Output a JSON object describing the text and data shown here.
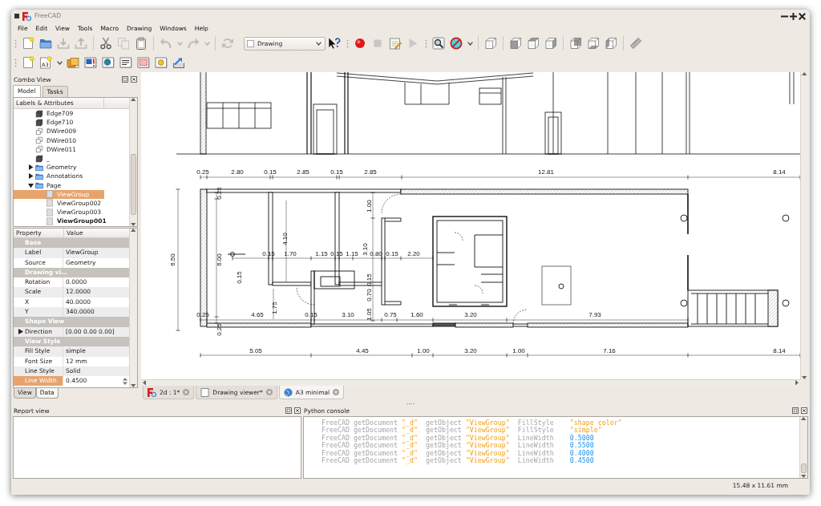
{
  "window": {
    "title": "FreeCAD"
  },
  "menu": [
    "File",
    "Edit",
    "View",
    "Tools",
    "Macro",
    "Drawing",
    "Windows",
    "Help"
  ],
  "toolbar_rows": [
    {
      "toolbars": [
        {
          "groups": [
            [
              {
                "kind": "new",
                "disabled": false
              },
              {
                "kind": "open",
                "disabled": false
              },
              {
                "kind": "save",
                "disabled": true
              },
              {
                "kind": "saveas",
                "disabled": true
              }
            ],
            [
              {
                "kind": "cut",
                "disabled": false
              },
              {
                "kind": "copy",
                "disabled": true
              },
              {
                "kind": "paste",
                "disabled": false
              }
            ],
            [
              {
                "kind": "undo",
                "disabled": true,
                "menu": true
              },
              {
                "kind": "redo",
                "disabled": true,
                "menu": true
              }
            ],
            [
              {
                "kind": "refresh",
                "disabled": true
              },
              {
                "kind": "workbench",
                "value": "Drawing",
                "disabled": false
              },
              {
                "kind": "whatsthis",
                "disabled": false
              }
            ]
          ]
        },
        {
          "groups": [
            [
              {
                "kind": "record",
                "disabled": false
              },
              {
                "kind": "stop",
                "disabled": true
              },
              {
                "kind": "macro",
                "disabled": false
              },
              {
                "kind": "play",
                "disabled": true
              }
            ]
          ]
        },
        {
          "groups": [
            [
              {
                "kind": "fitall",
                "disabled": false
              },
              {
                "kind": "drawstyle",
                "disabled": false,
                "menu": true
              }
            ],
            [
              {
                "kind": "isometric",
                "disabled": false
              }
            ],
            [
              {
                "kind": "front",
                "disabled": false
              },
              {
                "kind": "top",
                "disabled": false
              },
              {
                "kind": "right",
                "disabled": false
              }
            ],
            [
              {
                "kind": "rear",
                "disabled": false
              },
              {
                "kind": "bottom",
                "disabled": false
              },
              {
                "kind": "left",
                "disabled": false
              }
            ],
            [
              {
                "kind": "measure",
                "disabled": false
              }
            ]
          ]
        }
      ]
    },
    {
      "toolbars": [
        {
          "groups": [
            [
              {
                "kind": "newpage",
                "disabled": false
              },
              {
                "kind": "template",
                "label": "A3",
                "disabled": false,
                "menu": true
              },
              {
                "kind": "insertview",
                "disabled": false
              },
              {
                "kind": "projection",
                "disabled": false
              },
              {
                "kind": "openbrowser",
                "disabled": false
              },
              {
                "kind": "annotation",
                "disabled": false
              },
              {
                "kind": "clip",
                "disabled": false
              },
              {
                "kind": "symbol",
                "disabled": false
              },
              {
                "kind": "exportpage",
                "disabled": false
              }
            ]
          ]
        }
      ]
    }
  ],
  "combo_view": {
    "title": "Combo View",
    "tabs": [
      {
        "label": "Model",
        "selected": true
      },
      {
        "label": "Tasks",
        "selected": false
      }
    ],
    "tree": {
      "header": "Labels & Attributes",
      "items": [
        {
          "kind": "solid",
          "label": "Edge709",
          "selected": false
        },
        {
          "kind": "solid",
          "label": "Edge710",
          "selected": false
        },
        {
          "kind": "wire",
          "label": "DWire009",
          "selected": false
        },
        {
          "kind": "wire",
          "label": "DWire010",
          "selected": false
        },
        {
          "kind": "wire",
          "label": "DWire011",
          "selected": false
        },
        {
          "kind": "solid",
          "label": "_",
          "selected": false
        },
        {
          "kind": "folder",
          "label": "Geometry",
          "selected": false,
          "expanded": false
        },
        {
          "kind": "folder",
          "label": "Annotations",
          "selected": false,
          "expanded": false
        },
        {
          "kind": "folder",
          "label": "Page",
          "selected": false,
          "expanded": true,
          "children": [
            {
              "kind": "view",
              "label": "ViewGroup",
              "selected": true,
              "active": false
            },
            {
              "kind": "view",
              "label": "ViewGroup002",
              "selected": false,
              "active": false
            },
            {
              "kind": "view",
              "label": "ViewGroup003",
              "selected": false,
              "active": false
            },
            {
              "kind": "view",
              "label": "ViewGroup001",
              "selected": false,
              "active": true
            }
          ]
        }
      ]
    },
    "properties": {
      "columns": [
        "Property",
        "Value"
      ],
      "rows": [
        {
          "kind": "group",
          "label": "Base"
        },
        {
          "kind": "property",
          "name": "Label",
          "value": "ViewGroup",
          "selected": false
        },
        {
          "kind": "property",
          "name": "Source",
          "value": "Geometry",
          "selected": false
        },
        {
          "kind": "group",
          "label": "Drawing vi…"
        },
        {
          "kind": "property",
          "name": "Rotation",
          "value": "0.0000",
          "selected": false
        },
        {
          "kind": "property",
          "name": "Scale",
          "value": "12.0000",
          "selected": false
        },
        {
          "kind": "property",
          "name": "X",
          "value": "40.0000",
          "selected": false
        },
        {
          "kind": "property",
          "name": "Y",
          "value": "340.0000",
          "selected": false
        },
        {
          "kind": "group",
          "label": "Shape View"
        },
        {
          "kind": "property",
          "name": "Direction",
          "value": "[0.00 0.00 0.00]",
          "selected": false,
          "expanded": false
        },
        {
          "kind": "group",
          "label": "View Style"
        },
        {
          "kind": "property",
          "name": "Fill Style",
          "value": "simple",
          "selected": false
        },
        {
          "kind": "property",
          "name": "Font Size",
          "value": "12 mm",
          "selected": false
        },
        {
          "kind": "property",
          "name": "Line Style",
          "value": "Solid",
          "selected": false
        },
        {
          "kind": "property",
          "name": "Line Width",
          "value": "0.4500",
          "selected": true
        }
      ]
    },
    "bottom_tabs": [
      {
        "label": "View",
        "selected": false
      },
      {
        "label": "Data",
        "selected": true
      }
    ]
  },
  "drawing_view": {
    "dimension_labels": [
      "0.25",
      "2.80",
      "0.15",
      "2.85",
      "0.15",
      "2.85",
      "12.81",
      "8.14",
      "6.50",
      "0.25",
      "6.00",
      "4.10",
      "1.00",
      "0.15",
      "1.70",
      "1.15",
      "0.15",
      "1.15",
      "3.10",
      "0.80",
      "0.15",
      "2.20",
      "0.15",
      "0.15",
      "0.70",
      "1.75",
      "1.05",
      "0.25",
      "4.65",
      "0.15",
      "3.10",
      "0.75",
      "1.60",
      "3.20",
      "7.93",
      "0.25",
      "5.05",
      "4.45",
      "1.00",
      "3.20",
      "1.00",
      "7.16",
      "8.14"
    ]
  },
  "document_tabs": [
    {
      "kind": "document",
      "label": "2d : 1*",
      "selected": false
    },
    {
      "kind": "page",
      "label": "Drawing viewer*",
      "selected": false
    },
    {
      "kind": "web",
      "label": "A3 minimal",
      "selected": true
    }
  ],
  "report_view": {
    "title": "Report view"
  },
  "python_console": {
    "title": "Python console",
    "lines": [
      {
        "tokens": [
          {
            "kind": "code",
            "text": "FreeCAD getDocument"
          },
          {
            "kind": "string",
            "text": "\"_d\""
          },
          {
            "kind": "code",
            "text": "getObject"
          },
          {
            "kind": "string",
            "text": "\"ViewGroup\""
          },
          {
            "kind": "code",
            "text": "FillStyle"
          },
          {
            "kind": "string",
            "text": "\"shape color\""
          }
        ]
      },
      {
        "tokens": [
          {
            "kind": "code",
            "text": "FreeCAD getDocument"
          },
          {
            "kind": "string",
            "text": "\"_d\""
          },
          {
            "kind": "code",
            "text": "getObject"
          },
          {
            "kind": "string",
            "text": "\"ViewGroup\""
          },
          {
            "kind": "code",
            "text": "FillStyle"
          },
          {
            "kind": "string",
            "text": "\"simple\""
          }
        ]
      },
      {
        "tokens": [
          {
            "kind": "code",
            "text": "FreeCAD getDocument"
          },
          {
            "kind": "string",
            "text": "\"_d\""
          },
          {
            "kind": "code",
            "text": "getObject"
          },
          {
            "kind": "string",
            "text": "\"ViewGroup\""
          },
          {
            "kind": "code",
            "text": "LineWidth"
          },
          {
            "kind": "number",
            "text": "0.5000"
          }
        ]
      },
      {
        "tokens": [
          {
            "kind": "code",
            "text": "FreeCAD getDocument"
          },
          {
            "kind": "string",
            "text": "\"_d\""
          },
          {
            "kind": "code",
            "text": "getObject"
          },
          {
            "kind": "string",
            "text": "\"ViewGroup\""
          },
          {
            "kind": "code",
            "text": "LineWidth"
          },
          {
            "kind": "number",
            "text": "0.5500"
          }
        ]
      },
      {
        "tokens": [
          {
            "kind": "code",
            "text": "FreeCAD getDocument"
          },
          {
            "kind": "string",
            "text": "\"_d\""
          },
          {
            "kind": "code",
            "text": "getObject"
          },
          {
            "kind": "string",
            "text": "\"ViewGroup\""
          },
          {
            "kind": "code",
            "text": "LineWidth"
          },
          {
            "kind": "number",
            "text": "0.4000"
          }
        ]
      },
      {
        "tokens": [
          {
            "kind": "code",
            "text": "FreeCAD getDocument"
          },
          {
            "kind": "string",
            "text": "\"_d\""
          },
          {
            "kind": "code",
            "text": "getObject"
          },
          {
            "kind": "string",
            "text": "\"ViewGroup\""
          },
          {
            "kind": "code",
            "text": "LineWidth"
          },
          {
            "kind": "number",
            "text": "0.4500"
          }
        ]
      }
    ]
  },
  "status_bar": {
    "text": "15.48 x 11.61 mm"
  }
}
